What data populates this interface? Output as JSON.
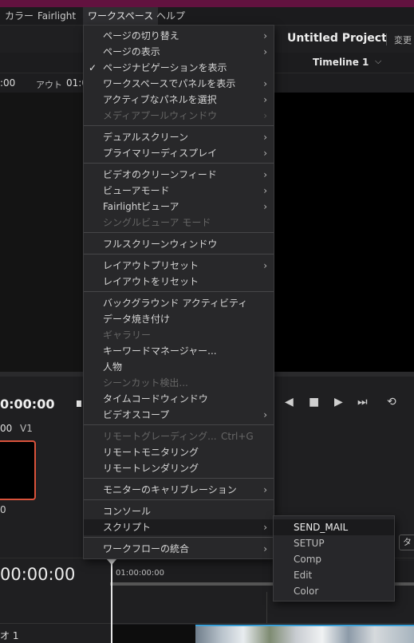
{
  "menubar": {
    "items": [
      {
        "label": "カラー"
      },
      {
        "label": "Fairlight"
      },
      {
        "label": "ワークスペース"
      },
      {
        "label": "ヘルプ"
      }
    ]
  },
  "project": {
    "title": "Untitled Project",
    "change": "変更"
  },
  "timeline": {
    "name": "Timeline 1"
  },
  "timecode": {
    "left": ":00",
    "out_label": "アウト",
    "out": "01:0",
    "big": "0:00:00",
    "huge": "00:00:00",
    "ruler": "01:00:00:00"
  },
  "clip": {
    "tc": "00",
    "track": "V1",
    "zero": "0"
  },
  "audio_track": {
    "label": "オ 1"
  },
  "tab_fragment": "タ",
  "menu": {
    "items": [
      {
        "label": "ページの切り替え",
        "arrow": true
      },
      {
        "label": "ページの表示",
        "arrow": true
      },
      {
        "label": "ページナビゲーションを表示",
        "checked": true
      },
      {
        "label": "ワークスペースでパネルを表示",
        "arrow": true
      },
      {
        "label": "アクティブなパネルを選択",
        "arrow": true
      },
      {
        "label": "メディアプールウィンドウ",
        "arrow": true,
        "disabled": true
      },
      {
        "label": "デュアルスクリーン",
        "arrow": true
      },
      {
        "label": "プライマリーディスプレイ",
        "arrow": true
      },
      {
        "label": "ビデオのクリーンフィード",
        "arrow": true
      },
      {
        "label": "ビューアモード",
        "arrow": true
      },
      {
        "label": "Fairlightビューア",
        "arrow": true
      },
      {
        "label": "シングルビューア モード",
        "disabled": true
      },
      {
        "label": "フルスクリーンウィンドウ"
      },
      {
        "label": "レイアウトプリセット",
        "arrow": true
      },
      {
        "label": "レイアウトをリセット"
      },
      {
        "label": "バックグラウンド アクティビティ"
      },
      {
        "label": "データ焼き付け"
      },
      {
        "label": "ギャラリー",
        "disabled": true
      },
      {
        "label": "キーワードマネージャー..."
      },
      {
        "label": "人物"
      },
      {
        "label": "シーンカット検出...",
        "disabled": true
      },
      {
        "label": "タイムコードウィンドウ"
      },
      {
        "label": "ビデオスコープ",
        "arrow": true
      },
      {
        "label": "リモートグレーディング...",
        "disabled": true,
        "shortcut": "Ctrl+G"
      },
      {
        "label": "リモートモニタリング"
      },
      {
        "label": "リモートレンダリング"
      },
      {
        "label": "モニターのキャリブレーション",
        "arrow": true
      },
      {
        "label": "コンソール"
      },
      {
        "label": "スクリプト",
        "arrow": true,
        "highlighted": true
      },
      {
        "label": "ワークフローの統合",
        "arrow": true
      }
    ]
  },
  "submenu": {
    "items": [
      {
        "label": "SEND_MAIL",
        "highlighted": true
      },
      {
        "label": "SETUP"
      },
      {
        "label": "Comp"
      },
      {
        "label": "Edit"
      },
      {
        "label": "Color"
      }
    ]
  },
  "icons": {
    "arrow": "›",
    "check": "✓",
    "chevron": "⌵"
  }
}
